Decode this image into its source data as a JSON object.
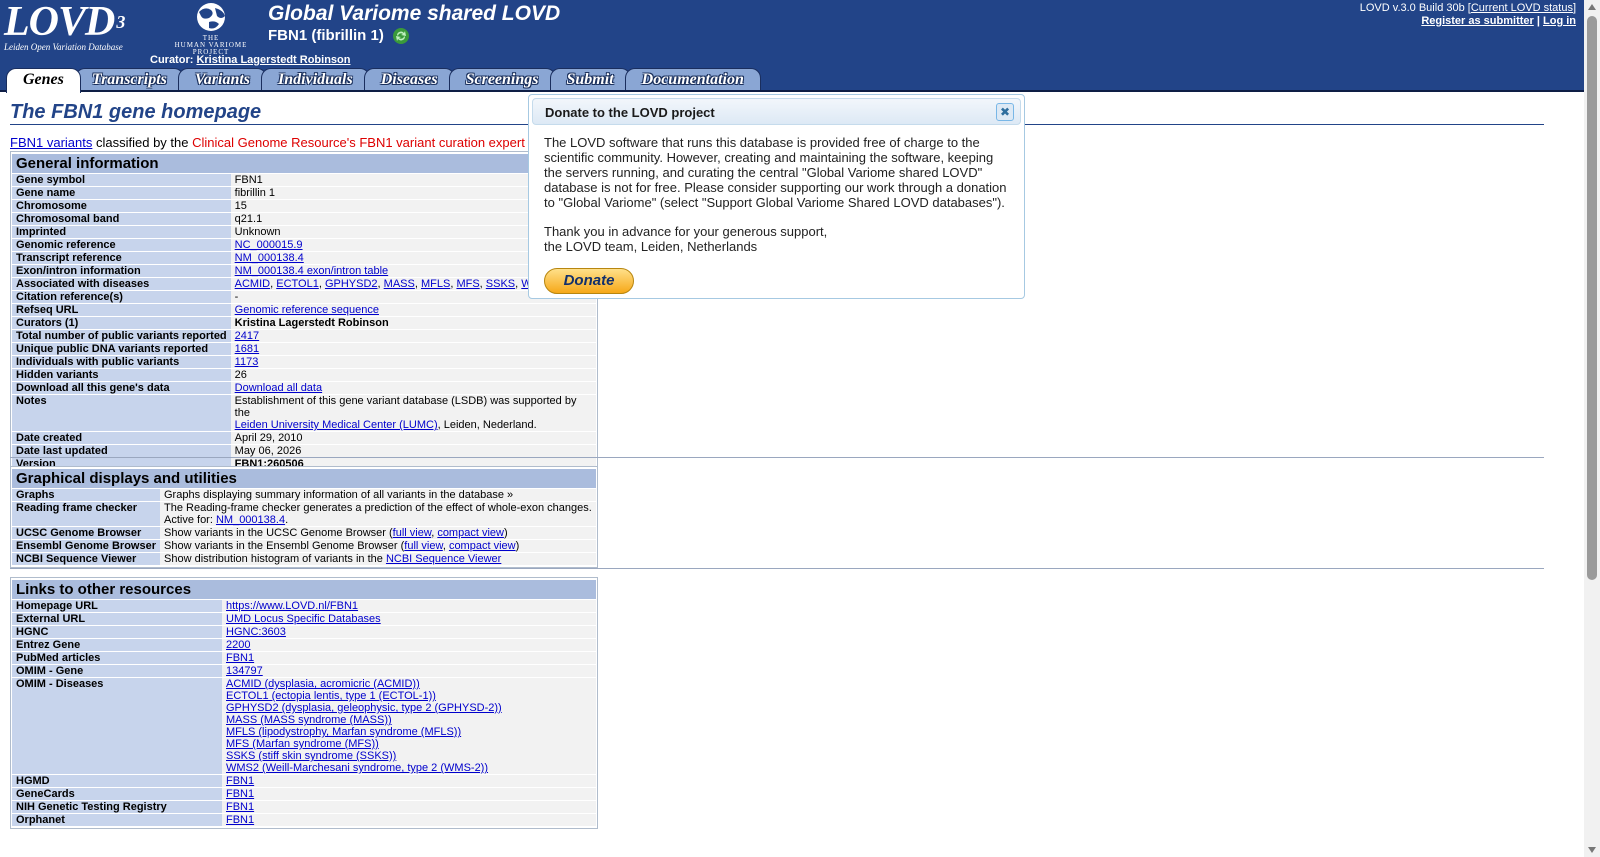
{
  "header": {
    "logo_text": "LOVD",
    "logo_sup": "3",
    "logo_sub": "Leiden Open Variation Database",
    "hvp_line1": "THE",
    "hvp_line2": "HUMAN VARIOME",
    "hvp_line3": "PROJECT",
    "site_title": "Global Variome shared LOVD",
    "gene_title": "FBN1 (fibrillin 1)",
    "curator_label": "Curator:",
    "curator_name": "Kristina Lagerstedt Robinson",
    "version_text": "LOVD v.3.0 Build 30b [",
    "current_status": "Current LOVD status",
    "version_close": "]",
    "register": "Register as submitter",
    "sep": "|",
    "login": "Log in"
  },
  "tabs": [
    "Genes",
    "Transcripts",
    "Variants",
    "Individuals",
    "Diseases",
    "Screenings",
    "Submit",
    "Documentation"
  ],
  "page_title": "The FBN1 gene homepage",
  "intro": {
    "link": "FBN1 variants",
    "text": "classified by the",
    "red": "Clinical Genome Resource's FBN1 variant curation expert pa"
  },
  "general": {
    "title": "General information",
    "gene_symbol": {
      "label": "Gene symbol",
      "value": "FBN1"
    },
    "gene_name": {
      "label": "Gene name",
      "value": "fibrillin 1"
    },
    "chromosome": {
      "label": "Chromosome",
      "value": "15"
    },
    "band": {
      "label": "Chromosomal band",
      "value": "q21.1"
    },
    "imprinted": {
      "label": "Imprinted",
      "value": "Unknown"
    },
    "genomic_ref": {
      "label": "Genomic reference",
      "value": "NC_000015.9"
    },
    "transcript_ref": {
      "label": "Transcript reference",
      "value": "NM_000138.4"
    },
    "exon": {
      "label": "Exon/intron information",
      "value": "NM_000138.4 exon/intron table"
    },
    "diseases": {
      "label": "Associated with diseases",
      "items": [
        "ACMID",
        "ECTOL1",
        "GPHYSD2",
        "MASS",
        "MFLS",
        "MFS",
        "SSKS",
        "WM"
      ]
    },
    "citation": {
      "label": "Citation reference(s)",
      "value": "-"
    },
    "refseq": {
      "label": "Refseq URL",
      "value": "Genomic reference sequence"
    },
    "curators": {
      "label": "Curators (1)",
      "value": "Kristina Lagerstedt Robinson"
    },
    "total_variants": {
      "label": "Total number of public variants reported",
      "value": "2417"
    },
    "unique_variants": {
      "label": "Unique public DNA variants reported",
      "value": "1681"
    },
    "individuals": {
      "label": "Individuals with public variants",
      "value": "1173"
    },
    "hidden": {
      "label": "Hidden variants",
      "value": "26"
    },
    "download": {
      "label": "Download all this gene's data",
      "value": "Download all data"
    },
    "notes": {
      "label": "Notes",
      "text1": "Establishment of this gene variant database (LSDB) was supported by the",
      "link": "Leiden University Medical Center (LUMC)",
      "text2": ", Leiden, Nederland."
    },
    "created": {
      "label": "Date created",
      "value": "April 29, 2010"
    },
    "updated": {
      "label": "Date last updated",
      "value": "May 06, 2026"
    },
    "version": {
      "label": "Version",
      "value": "FBN1:260506"
    }
  },
  "graphical": {
    "title": "Graphical displays and utilities",
    "graphs": {
      "label": "Graphs",
      "value": "Graphs displaying summary information of all variants in the database »"
    },
    "rfc": {
      "label": "Reading frame checker",
      "text": "The Reading-frame checker generates a prediction of the effect of whole-exon changes.",
      "active": "Active for:",
      "link": "NM_000138.4",
      "dot": "."
    },
    "ucsc": {
      "label": "UCSC Genome Browser",
      "text": "Show variants in the UCSC Genome Browser (",
      "full": "full view",
      "comma": ",",
      "compact": "compact view",
      "close": ")"
    },
    "ensembl": {
      "label": "Ensembl Genome Browser",
      "text": "Show variants in the Ensembl Genome Browser (",
      "full": "full view",
      "comma": ",",
      "compact": "compact view",
      "close": ")"
    },
    "ncbi": {
      "label": "NCBI Sequence Viewer",
      "text": "Show distribution histogram of variants in the",
      "link": "NCBI Sequence Viewer"
    }
  },
  "links": {
    "title": "Links to other resources",
    "homepage": {
      "label": "Homepage URL",
      "value": "https://www.LOVD.nl/FBN1"
    },
    "external": {
      "label": "External URL",
      "value": "UMD Locus Specific Databases"
    },
    "hgnc": {
      "label": "HGNC",
      "value": "HGNC:3603"
    },
    "entrez": {
      "label": "Entrez Gene",
      "value": "2200"
    },
    "pubmed": {
      "label": "PubMed articles",
      "value": "FBN1"
    },
    "omim_gene": {
      "label": "OMIM - Gene",
      "value": "134797"
    },
    "omim_diseases": {
      "label": "OMIM - Diseases",
      "items": [
        "ACMID (dysplasia, acromicric (ACMID))",
        "ECTOL1 (ectopia lentis, type 1 (ECTOL-1))",
        "GPHYSD2 (dysplasia, geleophysic, type 2 (GPHYSD-2))",
        "MASS (MASS syndrome (MASS))",
        "MFLS (lipodystrophy, Marfan syndrome (MFLS))",
        "MFS (Marfan syndrome (MFS))",
        "SSKS (stiff skin syndrome (SSKS))",
        "WMS2 (Weill-Marchesani syndrome, type 2 (WMS-2))"
      ]
    },
    "hgmd": {
      "label": "HGMD",
      "value": "FBN1"
    },
    "genecards": {
      "label": "GeneCards",
      "value": "FBN1"
    },
    "nih": {
      "label": "NIH Genetic Testing Registry",
      "value": "FBN1"
    },
    "orphanet": {
      "label": "Orphanet",
      "value": "FBN1"
    }
  },
  "dialog": {
    "title": "Donate to the LOVD project",
    "close_symbol": "✖",
    "para1": "The LOVD software that runs this database is provided free of charge to the scientific community. However, creating and maintaining the software, keeping the servers running, and curating the central \"Global Variome shared LOVD\" database is not for free. Please consider supporting our work through a donation to \"Global Variome\" (select \"Support Global Variome Shared LOVD databases\").",
    "para2_line1": "Thank you in advance for your generous support,",
    "para2_line2": "the LOVD team, Leiden, Netherlands",
    "donate_label": "Donate"
  },
  "colors": {
    "header_bg": "#224488",
    "section_bg": "#aabcdd",
    "label_bg": "#c7d4ec",
    "accent_red": "#dd0000"
  }
}
